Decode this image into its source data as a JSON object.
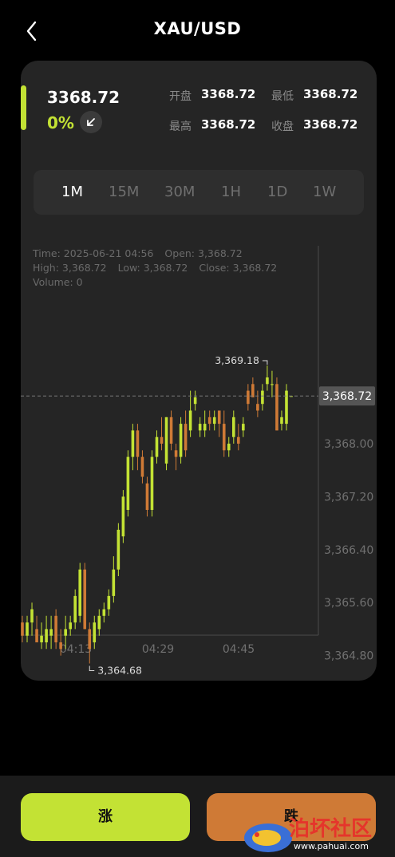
{
  "header": {
    "title": "XAU/USD",
    "back_icon": "chevron-left-icon"
  },
  "quote": {
    "price": "3368.72",
    "change": "0%",
    "direction_icon": "arrow-down-left-icon",
    "accent_color": "#c3e234",
    "stats": [
      {
        "label": "开盘",
        "value": "3368.72"
      },
      {
        "label": "最低",
        "value": "3368.72"
      },
      {
        "label": "最高",
        "value": "3368.72"
      },
      {
        "label": "收盘",
        "value": "3368.72"
      }
    ]
  },
  "tabs": {
    "items": [
      "1M",
      "15M",
      "30M",
      "1H",
      "1D",
      "1W"
    ],
    "active": "1M"
  },
  "chart_info": {
    "time": "Time: 2025-06-21 04:56",
    "open": "Open: 3,368.72",
    "high": "High: 3,368.72",
    "low": "Low: 3,368.72",
    "close": "Close: 3,368.72",
    "volume": "Volume: 0"
  },
  "chart_data": {
    "type": "candlestick",
    "up_color": "#c3e234",
    "down_color": "#cf7a36",
    "y_ticks": [
      "3,368.00",
      "3,367.20",
      "3,366.40",
      "3,365.60",
      "3,364.80"
    ],
    "y_tick_values": [
      3368.0,
      3367.2,
      3366.4,
      3365.6,
      3364.8
    ],
    "x_ticks": [
      "04:13",
      "04:29",
      "04:45"
    ],
    "last_price": "3,368.72",
    "last_price_value": 3368.72,
    "max_label": "3,369.18",
    "max_value": 3369.18,
    "min_label": "3,364.68",
    "min_value": 3364.68,
    "candles": [
      [
        3365.3,
        3365.4,
        3365.0,
        3365.1
      ],
      [
        3365.1,
        3365.4,
        3365.0,
        3365.3
      ],
      [
        3365.3,
        3365.6,
        3365.1,
        3365.5
      ],
      [
        3365.2,
        3365.4,
        3365.0,
        3365.0
      ],
      [
        3365.0,
        3365.3,
        3364.9,
        3365.1
      ],
      [
        3365.0,
        3365.4,
        3364.9,
        3365.2
      ],
      [
        3365.1,
        3365.4,
        3364.9,
        3365.2
      ],
      [
        3365.4,
        3365.5,
        3364.9,
        3365.0
      ],
      [
        3365.0,
        3365.2,
        3364.8,
        3364.9
      ],
      [
        3365.1,
        3365.4,
        3364.9,
        3365.2
      ],
      [
        3365.2,
        3365.4,
        3365.1,
        3365.3
      ],
      [
        3365.3,
        3365.8,
        3365.2,
        3365.7
      ],
      [
        3365.4,
        3366.2,
        3365.3,
        3366.1
      ],
      [
        3366.1,
        3366.2,
        3365.2,
        3365.2
      ],
      [
        3365.2,
        3365.3,
        3364.68,
        3364.9
      ],
      [
        3365.0,
        3365.4,
        3364.9,
        3365.3
      ],
      [
        3365.2,
        3365.5,
        3365.1,
        3365.4
      ],
      [
        3365.4,
        3365.6,
        3365.3,
        3365.5
      ],
      [
        3365.5,
        3365.8,
        3365.4,
        3365.7
      ],
      [
        3365.7,
        3366.3,
        3365.6,
        3366.1
      ],
      [
        3366.1,
        3366.8,
        3366.0,
        3366.7
      ],
      [
        3366.6,
        3367.3,
        3366.5,
        3367.2
      ],
      [
        3367.0,
        3367.9,
        3366.9,
        3367.8
      ],
      [
        3367.8,
        3368.3,
        3367.6,
        3368.2
      ],
      [
        3368.2,
        3368.3,
        3367.6,
        3367.8
      ],
      [
        3367.8,
        3367.9,
        3367.4,
        3367.5
      ],
      [
        3367.4,
        3367.5,
        3366.9,
        3367.0
      ],
      [
        3367.0,
        3367.9,
        3366.9,
        3367.8
      ],
      [
        3367.8,
        3368.2,
        3367.7,
        3368.1
      ],
      [
        3368.1,
        3368.4,
        3367.9,
        3368.0
      ],
      [
        3367.7,
        3368.4,
        3367.6,
        3368.4
      ],
      [
        3368.4,
        3368.5,
        3367.9,
        3368.0
      ],
      [
        3367.9,
        3368.0,
        3367.6,
        3367.8
      ],
      [
        3367.8,
        3368.4,
        3367.7,
        3368.3
      ],
      [
        3368.3,
        3368.5,
        3367.8,
        3367.9
      ],
      [
        3368.2,
        3368.8,
        3368.1,
        3368.5
      ],
      [
        3368.6,
        3368.8,
        3368.5,
        3368.7
      ],
      [
        3368.2,
        3368.4,
        3368.1,
        3368.3
      ],
      [
        3368.2,
        3368.5,
        3368.1,
        3368.3
      ],
      [
        3368.4,
        3368.5,
        3368.2,
        3368.3
      ],
      [
        3368.3,
        3368.5,
        3368.2,
        3368.4
      ],
      [
        3368.5,
        3368.5,
        3368.1,
        3368.3
      ],
      [
        3368.3,
        3368.5,
        3367.8,
        3367.9
      ],
      [
        3367.9,
        3368.1,
        3367.8,
        3368.0
      ],
      [
        3368.1,
        3368.5,
        3368.0,
        3368.4
      ],
      [
        3368.1,
        3368.3,
        3367.9,
        3368.0
      ],
      [
        3368.2,
        3368.4,
        3368.1,
        3368.3
      ],
      [
        3368.8,
        3368.9,
        3368.5,
        3368.6
      ],
      [
        3368.9,
        3369.0,
        3368.7,
        3368.7
      ],
      [
        3368.6,
        3368.8,
        3368.4,
        3368.5
      ],
      [
        3368.6,
        3368.9,
        3368.5,
        3368.8
      ],
      [
        3368.9,
        3369.18,
        3368.8,
        3369.0
      ],
      [
        3368.9,
        3369.1,
        3368.7,
        3368.9
      ],
      [
        3368.9,
        3369.0,
        3368.2,
        3368.2
      ],
      [
        3368.3,
        3368.5,
        3368.2,
        3368.4
      ],
      [
        3368.3,
        3368.9,
        3368.2,
        3368.8
      ],
      [
        3368.72,
        3368.72,
        3368.72,
        3368.72
      ]
    ]
  },
  "actions": {
    "up_label": "涨",
    "down_label": "跌"
  },
  "watermark": {
    "text": "泊坏社区",
    "url": "www.pahuai.com"
  }
}
